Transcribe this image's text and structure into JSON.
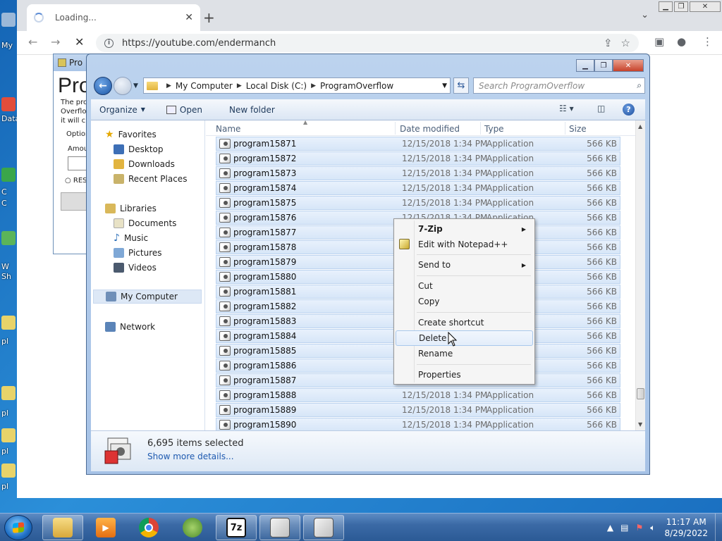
{
  "desktop": {
    "labels": [
      "My",
      "Data",
      "C",
      "C",
      "W",
      "Sh",
      "pl",
      "pl",
      "pl",
      "pl"
    ]
  },
  "browser": {
    "tab_title": "Loading...",
    "tab_close": "✕",
    "new_tab": "+",
    "url": "https://youtube.com/endermanch",
    "back": "←",
    "forward": "→",
    "stop": "✕"
  },
  "program_window": {
    "title": "Pro",
    "heading": "Pro",
    "lines": [
      "The pro",
      "Overflo",
      "it will cr"
    ],
    "option": "Option",
    "amount": "Amou",
    "radio": "RES"
  },
  "explorer": {
    "breadcrumb": [
      "My Computer",
      "Local Disk (C:)",
      "ProgramOverflow"
    ],
    "search_placeholder": "Search ProgramOverflow",
    "commands": {
      "organize": "Organize",
      "open": "Open",
      "new_folder": "New folder"
    },
    "nav": {
      "favorites": "Favorites",
      "desktop": "Desktop",
      "downloads": "Downloads",
      "recent": "Recent Places",
      "libraries": "Libraries",
      "documents": "Documents",
      "music": "Music",
      "pictures": "Pictures",
      "videos": "Videos",
      "computer": "My Computer",
      "network": "Network"
    },
    "columns": {
      "name": "Name",
      "date": "Date modified",
      "type": "Type",
      "size": "Size"
    },
    "files": [
      {
        "name": "program15871",
        "date": "12/15/2018 1:34 PM",
        "type": "Application",
        "size": "566 KB"
      },
      {
        "name": "program15872",
        "date": "12/15/2018 1:34 PM",
        "type": "Application",
        "size": "566 KB"
      },
      {
        "name": "program15873",
        "date": "12/15/2018 1:34 PM",
        "type": "Application",
        "size": "566 KB"
      },
      {
        "name": "program15874",
        "date": "12/15/2018 1:34 PM",
        "type": "Application",
        "size": "566 KB"
      },
      {
        "name": "program15875",
        "date": "12/15/2018 1:34 PM",
        "type": "Application",
        "size": "566 KB"
      },
      {
        "name": "program15876",
        "date": "12/15/2018 1:34 PM",
        "type": "Application",
        "size": "566 KB"
      },
      {
        "name": "program15877",
        "date": "",
        "type": "",
        "size": "566 KB"
      },
      {
        "name": "program15878",
        "date": "",
        "type": "",
        "size": "566 KB"
      },
      {
        "name": "program15879",
        "date": "",
        "type": "",
        "size": "566 KB"
      },
      {
        "name": "program15880",
        "date": "",
        "type": "",
        "size": "566 KB"
      },
      {
        "name": "program15881",
        "date": "",
        "type": "",
        "size": "566 KB"
      },
      {
        "name": "program15882",
        "date": "",
        "type": "",
        "size": "566 KB"
      },
      {
        "name": "program15883",
        "date": "",
        "type": "",
        "size": "566 KB"
      },
      {
        "name": "program15884",
        "date": "",
        "type": "",
        "size": "566 KB"
      },
      {
        "name": "program15885",
        "date": "",
        "type": "",
        "size": "566 KB"
      },
      {
        "name": "program15886",
        "date": "",
        "type": "",
        "size": "566 KB"
      },
      {
        "name": "program15887",
        "date": "",
        "type": "",
        "size": "566 KB"
      },
      {
        "name": "program15888",
        "date": "12/15/2018 1:34 PM",
        "type": "Application",
        "size": "566 KB"
      },
      {
        "name": "program15889",
        "date": "12/15/2018 1:34 PM",
        "type": "Application",
        "size": "566 KB"
      },
      {
        "name": "program15890",
        "date": "12/15/2018 1:34 PM",
        "type": "Application",
        "size": "566 KB"
      }
    ],
    "selected_count": "6,695 items selected",
    "show_more": "Show more details..."
  },
  "context_menu": {
    "zip": "7-Zip",
    "notepad": "Edit with Notepad++",
    "send_to": "Send to",
    "cut": "Cut",
    "copy": "Copy",
    "create_shortcut": "Create shortcut",
    "delete": "Delete",
    "rename": "Rename",
    "properties": "Properties"
  },
  "taskbar": {
    "zip_label": "7z",
    "time": "11:17 AM",
    "date": "8/29/2022"
  },
  "colors": {
    "selection_row": "#d7e6f8",
    "menu_highlight": "#a8c8ec",
    "taskbar": "#3b6aa6"
  }
}
